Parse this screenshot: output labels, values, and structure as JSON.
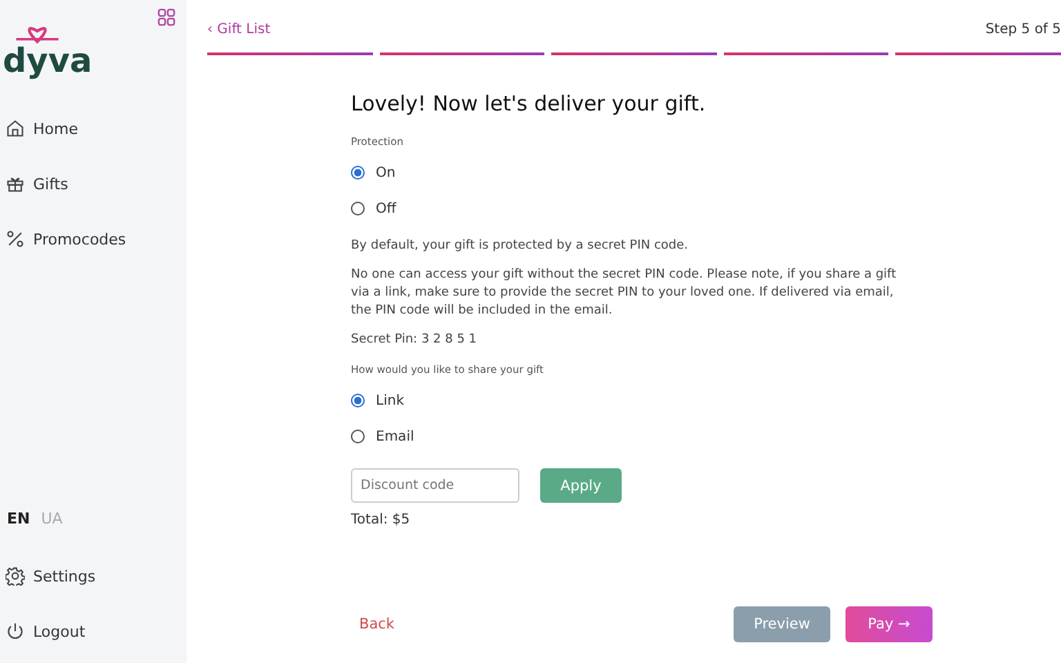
{
  "sidebar": {
    "logo": "dyva",
    "nav": [
      {
        "kind": "home",
        "label": "Home"
      },
      {
        "kind": "gift",
        "label": "Gifts"
      },
      {
        "kind": "percent",
        "label": "Promocodes"
      }
    ],
    "languages": [
      {
        "label": "EN",
        "selected": true
      },
      {
        "label": "UA",
        "selected": false
      }
    ],
    "bottom": [
      {
        "kind": "settings",
        "label": "Settings"
      },
      {
        "kind": "logout",
        "label": "Logout"
      }
    ]
  },
  "header": {
    "back_link": "‹ Gift List",
    "step": "Step 5 of 5",
    "progress": [
      {
        "done": true
      },
      {
        "done": true
      },
      {
        "done": true
      },
      {
        "done": true
      },
      {
        "done": true
      }
    ]
  },
  "form": {
    "title": "Lovely! Now let's deliver your gift.",
    "protection": {
      "label": "Protection",
      "options": [
        {
          "label": "On",
          "selected": true
        },
        {
          "label": "Off",
          "selected": false
        }
      ]
    },
    "notes": [
      "By default, your gift is protected by a secret PIN code.",
      "No one can access your gift without the secret PIN code. Please note, if you share a gift via a link, make sure to provide the secret PIN to your loved one. If delivered via email, the PIN code will be included in the email.",
      "Secret Pin: 3 2 8 5 1"
    ],
    "share": {
      "label": "How would you like to share your gift",
      "options": [
        {
          "label": "Link",
          "selected": true
        },
        {
          "label": "Email",
          "selected": false
        }
      ]
    },
    "discount": {
      "placeholder": "Discount code",
      "button": "Apply"
    },
    "total": "Total: $5"
  },
  "footer": {
    "back": "Back",
    "preview": "Preview",
    "pay": "Pay →"
  }
}
